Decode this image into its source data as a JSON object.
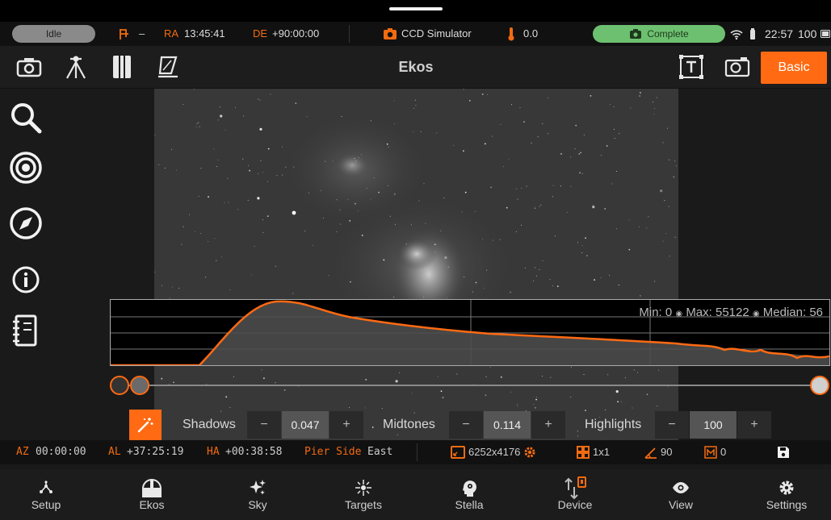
{
  "status": {
    "state": "Idle",
    "mount_dash": "–",
    "ra_label": "RA",
    "ra_value": "13:45:41",
    "de_label": "DE",
    "de_value": "+90:00:00",
    "camera_name": "CCD Simulator",
    "temperature": "0.0",
    "capture_state": "Complete",
    "time": "22:57",
    "battery": "100"
  },
  "toolbar": {
    "title": "Ekos",
    "basic_label": "Basic"
  },
  "histogram": {
    "min_label": "Min: 0",
    "max_label": "Max: 55122",
    "median_label": "Median: 56",
    "sep": "◉"
  },
  "stretch": {
    "shadows_label": "Shadows",
    "shadows_value": "0.047",
    "midtones_label": "Midtones",
    "midtones_value": "0.114",
    "highlights_label": "Highlights",
    "highlights_value": "100",
    "minus": "−",
    "plus": "+"
  },
  "info": {
    "az_label": "AZ",
    "az_value": "00:00:00",
    "al_label": "AL",
    "al_value": "+37:25:19",
    "ha_label": "HA",
    "ha_value": "+00:38:58",
    "pier_label": "Pier Side",
    "pier_value": "East",
    "resolution": "6252x4176",
    "binning": "1x1",
    "angle": "90",
    "offset": "0"
  },
  "nav": [
    {
      "label": "Setup"
    },
    {
      "label": "Ekos"
    },
    {
      "label": "Sky"
    },
    {
      "label": "Targets"
    },
    {
      "label": "Stella"
    },
    {
      "label": "Device"
    },
    {
      "label": "View"
    },
    {
      "label": "Settings"
    }
  ],
  "colors": {
    "accent": "#ff6a13",
    "complete": "#6dc070",
    "idle": "#8a8a8a"
  }
}
